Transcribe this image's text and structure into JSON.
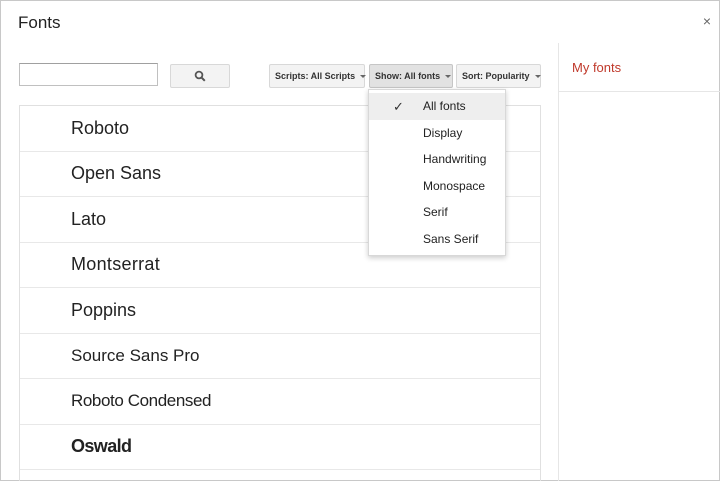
{
  "dialog": {
    "title": "Fonts",
    "close_label": "×"
  },
  "search": {
    "value": "",
    "placeholder": "",
    "button_icon": "search-icon"
  },
  "filters": {
    "scripts_label": "Scripts: All Scripts",
    "show_label": "Show: All fonts",
    "sort_label": "Sort: Popularity"
  },
  "fonts": [
    "Roboto",
    "Open Sans",
    "Lato",
    "Montserrat",
    "Poppins",
    "Source Sans Pro",
    "Roboto Condensed",
    "Oswald"
  ],
  "side_panel": {
    "title": "My fonts"
  },
  "show_menu": {
    "check_glyph": "✓",
    "selected_index": 0,
    "items": [
      "All fonts",
      "Display",
      "Handwriting",
      "Monospace",
      "Serif",
      "Sans Serif"
    ]
  },
  "colors": {
    "accent": "#c0392b",
    "menu_highlight": "#eeeeee"
  }
}
